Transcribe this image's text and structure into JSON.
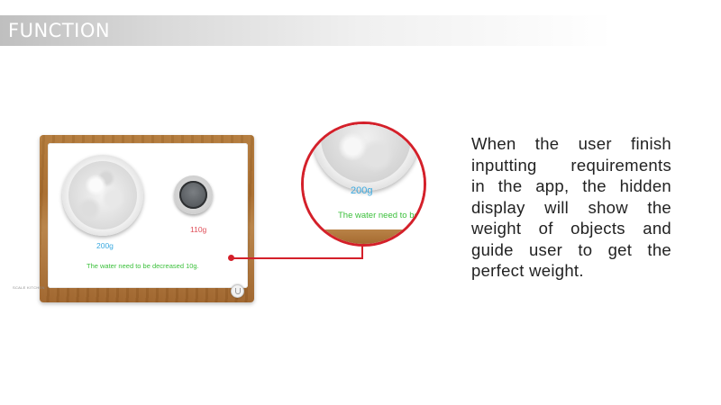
{
  "header": {
    "title": "FUNCTION"
  },
  "scale": {
    "flour_weight": "200g",
    "water_weight": "110g",
    "message": "The water need to be decreased 10g.",
    "brand_label": "SCALE KITCHEN"
  },
  "zoom": {
    "flour_weight": "200g",
    "message": "The water need to be"
  },
  "description": {
    "lines": [
      "When the user finish",
      "inputting requirements",
      "in the app, the hidden",
      "display will show the",
      "weight of objects and",
      "guide user to get the",
      "perfect weight."
    ]
  },
  "colors": {
    "callout": "#d4202a",
    "weight_blue": "#3aa9e0",
    "weight_red": "#e0505a",
    "message_green": "#3cc03c"
  }
}
